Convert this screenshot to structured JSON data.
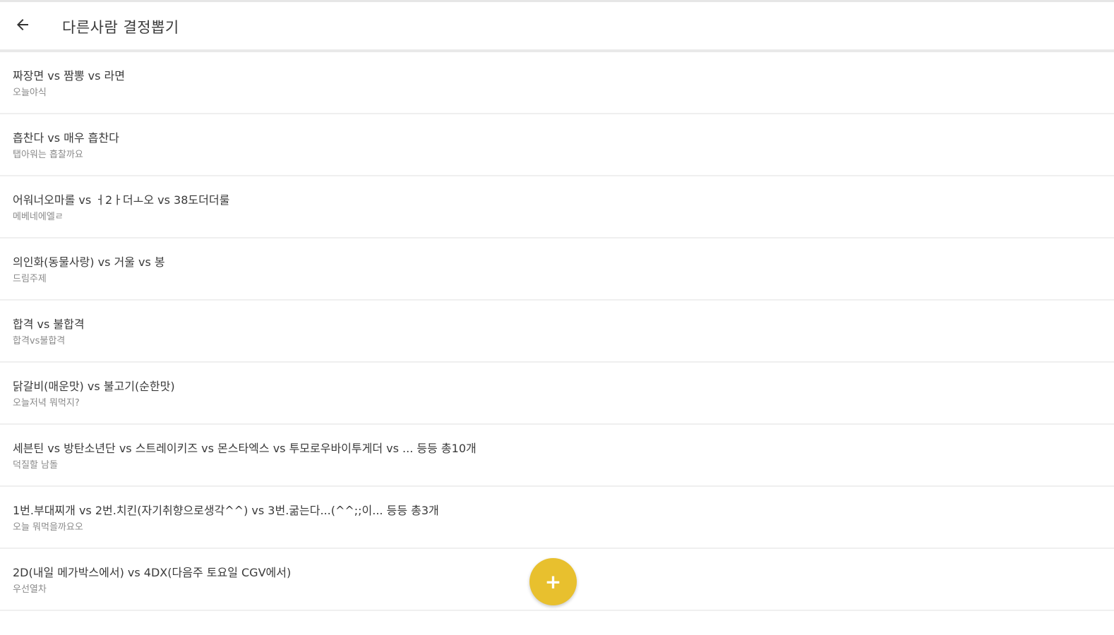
{
  "app_bar": {
    "title": "다른사람 결정뽑기",
    "back_icon": "arrow-left-icon"
  },
  "items": [
    {
      "title": "짜장면 vs 짬뽕 vs 라면",
      "subtitle": "오늘야식"
    },
    {
      "title": "흡찬다 vs 매우 흡찬다",
      "subtitle": "탭아워는 흡찰까요"
    },
    {
      "title": "어워너오마롤 vs ㅓ2ㅏ더ㅗ오 vs 38도더더룰",
      "subtitle": "메베네에엘ㄹ"
    },
    {
      "title": "의인화(동물사랑) vs 거울 vs 봉",
      "subtitle": "드림주제"
    },
    {
      "title": "합격 vs 불합격",
      "subtitle": "합격vs불합격"
    },
    {
      "title": "닭갈비(매운맛) vs 불고기(순한맛)",
      "subtitle": "오늘저녁 뭐먹지?"
    },
    {
      "title": "세븐틴 vs 방탄소년단 vs 스트레이키즈 vs 몬스타엑스 vs 투모로우바이투게더 vs ... 등등 총10개",
      "subtitle": "덕질할 남돌"
    },
    {
      "title": "1번.부대찌개 vs 2번.치킨(자기취향으로생각^^) vs 3번.굶는다...(^^;;이... 등등 총3개",
      "subtitle": "오늘 뭐먹을까요오"
    },
    {
      "title": "2D(내일 메가박스에서) vs 4DX(다음주 토요일 CGV에서)",
      "subtitle": "우선열차"
    }
  ],
  "fab": {
    "icon": "plus-icon",
    "symbol": "+",
    "color": "#e8c02e"
  }
}
